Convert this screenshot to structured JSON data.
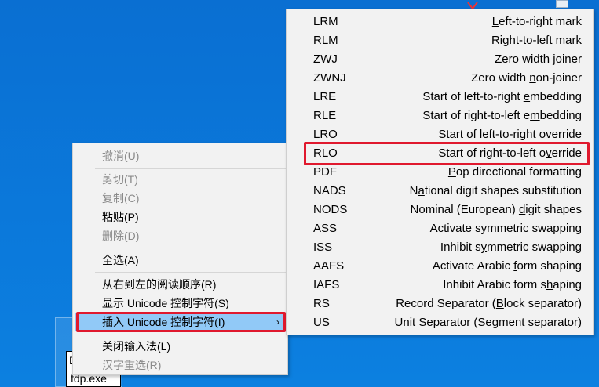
{
  "desktop": {
    "file_name_partial": "D",
    "file_name": "fdp.exe"
  },
  "context_menu": {
    "items": [
      {
        "label": "撤消(U)",
        "enabled": false
      },
      {
        "label": "剪切(T)",
        "enabled": false
      },
      {
        "label": "复制(C)",
        "enabled": false
      },
      {
        "label": "粘贴(P)",
        "enabled": true
      },
      {
        "label": "删除(D)",
        "enabled": false
      },
      {
        "label": "全选(A)",
        "enabled": true
      },
      {
        "label": "从右到左的阅读顺序(R)",
        "enabled": true
      },
      {
        "label": "显示 Unicode 控制字符(S)",
        "enabled": true
      },
      {
        "label": "插入 Unicode 控制字符(I)",
        "enabled": true,
        "has_submenu": true,
        "highlighted": true
      },
      {
        "label": "关闭输入法(L)",
        "enabled": true
      },
      {
        "label": "汉字重选(R)",
        "enabled": false
      }
    ],
    "submenu_arrow": "›"
  },
  "submenu": {
    "items": [
      {
        "code": "LRM",
        "pre": "",
        "acc": "L",
        "post": "eft-to-right mark"
      },
      {
        "code": "RLM",
        "pre": "",
        "acc": "R",
        "post": "ight-to-left mark"
      },
      {
        "code": "ZWJ",
        "pre": "Zero width joiner",
        "acc": "",
        "post": ""
      },
      {
        "code": "ZWNJ",
        "pre": "Zero width ",
        "acc": "n",
        "post": "on-joiner"
      },
      {
        "code": "LRE",
        "pre": "Start of left-to-right ",
        "acc": "e",
        "post": "mbedding"
      },
      {
        "code": "RLE",
        "pre": "Start of right-to-left e",
        "acc": "m",
        "post": "bedding"
      },
      {
        "code": "LRO",
        "pre": "Start of left-to-right ",
        "acc": "o",
        "post": "verride"
      },
      {
        "code": "RLO",
        "pre": "Start of right-to-left o",
        "acc": "v",
        "post": "erride",
        "highlighted": true
      },
      {
        "code": "PDF",
        "pre": "",
        "acc": "P",
        "post": "op directional formatting"
      },
      {
        "code": "NADS",
        "pre": "N",
        "acc": "a",
        "post": "tional digit shapes substitution"
      },
      {
        "code": "NODS",
        "pre": "Nominal (European) ",
        "acc": "d",
        "post": "igit shapes"
      },
      {
        "code": "ASS",
        "pre": "Activate ",
        "acc": "s",
        "post": "ymmetric swapping"
      },
      {
        "code": "ISS",
        "pre": "Inhibit s",
        "acc": "y",
        "post": "mmetric swapping"
      },
      {
        "code": "AAFS",
        "pre": "Activate Arabic ",
        "acc": "f",
        "post": "orm shaping"
      },
      {
        "code": "IAFS",
        "pre": "Inhibit Arabic form s",
        "acc": "h",
        "post": "aping"
      },
      {
        "code": "RS",
        "pre": "Record Separator (",
        "acc": "B",
        "post": "lock separator)"
      },
      {
        "code": "US",
        "pre": "Unit Separator (",
        "acc": "S",
        "post": "egment separator)"
      }
    ]
  },
  "colors": {
    "desktop_bg": "#0b79db",
    "menu_bg": "#f2f2f2",
    "hover_bg": "#91c9f7",
    "highlight_border": "#e0192e",
    "disabled_text": "#8a8a8a"
  }
}
